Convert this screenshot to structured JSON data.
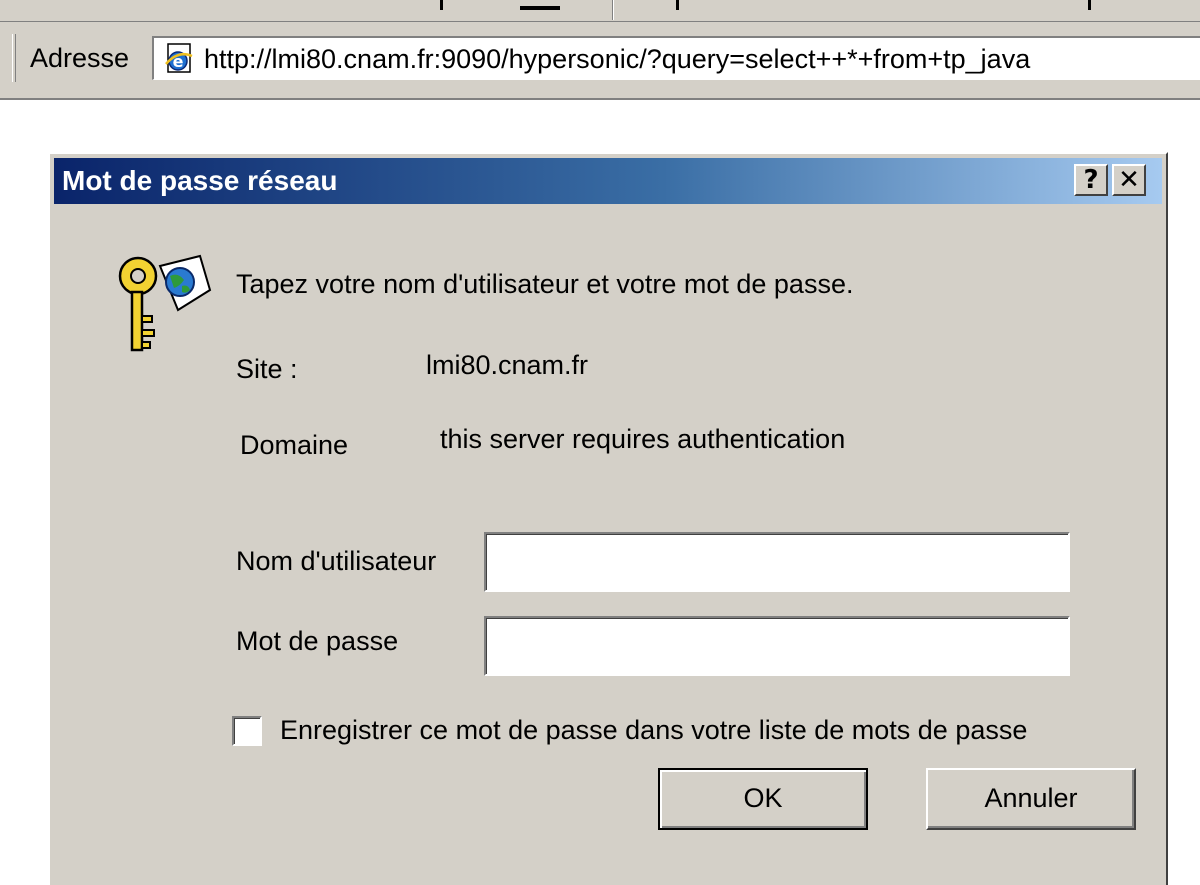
{
  "browser": {
    "address_label": "Adresse",
    "address_url": "http://lmi80.cnam.fr:9090/hypersonic/?query=select++*+from+tp_java"
  },
  "dialog": {
    "title": "Mot de passe réseau",
    "help_button": "?",
    "close_button": "✕",
    "prompt": "Tapez votre nom d'utilisateur et votre mot de passe.",
    "site_label": "Site :",
    "site_value": "lmi80.cnam.fr",
    "domain_label": "Domaine",
    "domain_value": "this server requires authentication",
    "username_label": "Nom d'utilisateur",
    "username_value": "",
    "password_label": "Mot de passe",
    "password_value": "",
    "remember_label": "Enregistrer ce mot de passe dans votre liste de mots de passe",
    "remember_checked": false,
    "ok_label": "OK",
    "cancel_label": "Annuler"
  },
  "icons": {
    "browser_icon": "ie-page-icon",
    "dialog_icon": "key-globe-icon"
  },
  "colors": {
    "titlebar_start": "#0a246a",
    "titlebar_end": "#a6caf0",
    "dialog_face": "#d4d0c8"
  }
}
